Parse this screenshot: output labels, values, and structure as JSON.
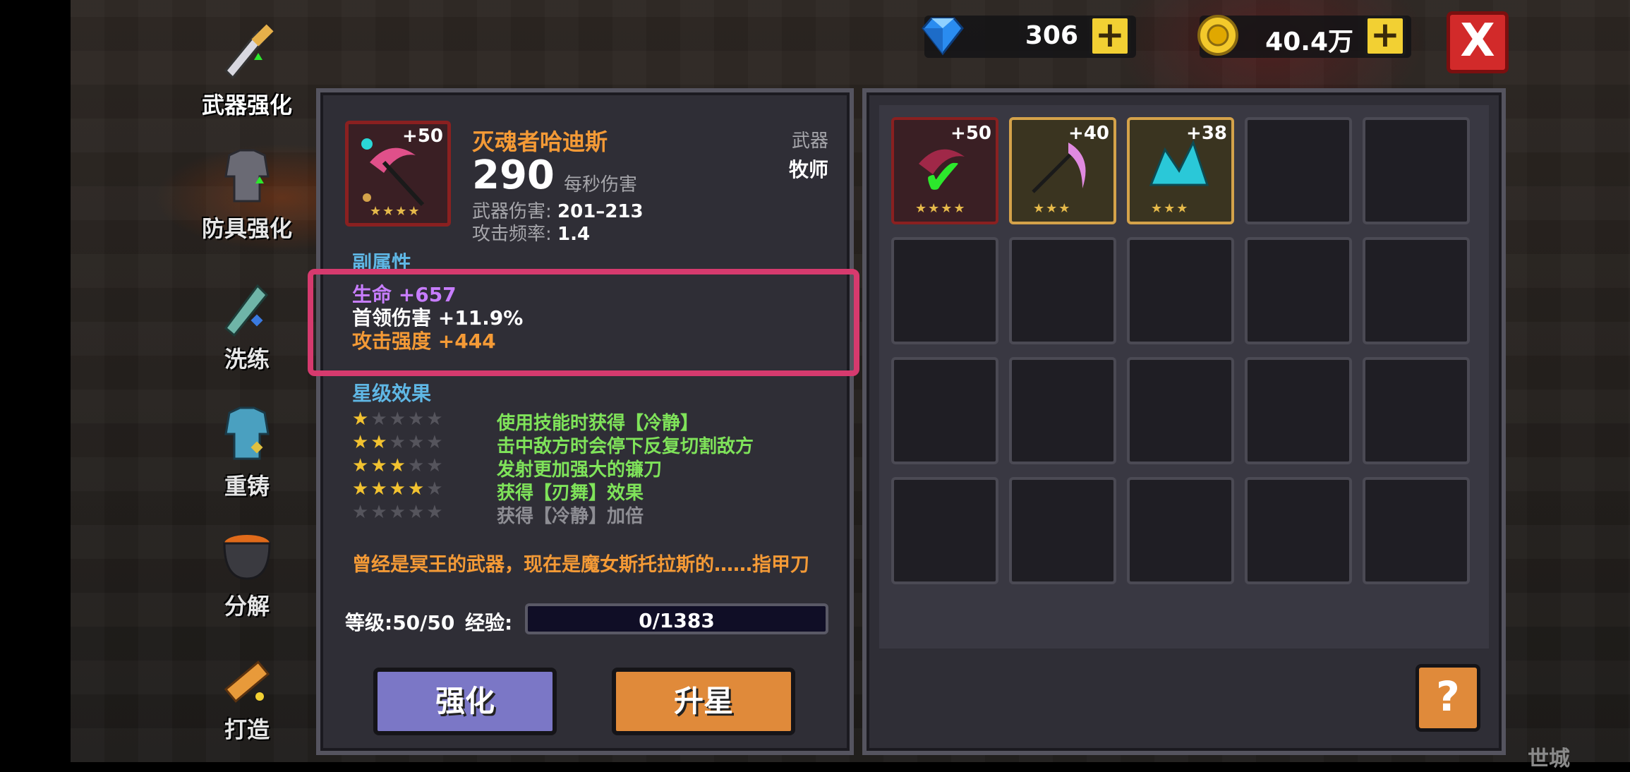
{
  "currency": {
    "gems": "306",
    "gold": "40.4万",
    "plus": "+"
  },
  "close_label": "X",
  "sidebar": {
    "items": [
      {
        "label": "武器强化",
        "icon": "sword-upgrade-icon"
      },
      {
        "label": "防具强化",
        "icon": "armor-upgrade-icon"
      },
      {
        "label": "洗练",
        "icon": "refine-sword-icon"
      },
      {
        "label": "重铸",
        "icon": "reforge-armor-icon"
      },
      {
        "label": "分解",
        "icon": "cauldron-icon"
      },
      {
        "label": "打造",
        "icon": "forge-hammer-icon"
      }
    ]
  },
  "weapon": {
    "name": "灭魂者哈迪斯",
    "dps": "290",
    "dps_label": "每秒伤害",
    "type": "武器",
    "class": "牧师",
    "plus": "+50",
    "stars": "★★★★",
    "damage_label": "武器伤害:",
    "damage_value": "201–213",
    "rate_label": "攻击频率:",
    "rate_value": "1.4"
  },
  "sub_attr": {
    "title": "副属性",
    "stats": [
      {
        "text": "生命 +657",
        "color": "#c77dff"
      },
      {
        "text": "首领伤害 +11.9%",
        "color": "#ffffff"
      },
      {
        "text": "攻击强度 +444",
        "color": "#f49a36"
      }
    ]
  },
  "star_effects": {
    "title": "星级效果",
    "rows": [
      {
        "on": 1,
        "text": "使用技能时获得【冷静】"
      },
      {
        "on": 2,
        "text": "击中敌方时会停下反复切割敌方"
      },
      {
        "on": 3,
        "text": "发射更加强大的镰刀"
      },
      {
        "on": 4,
        "text": "获得【刃舞】效果"
      },
      {
        "on": 0,
        "text": "获得【冷静】加倍"
      }
    ]
  },
  "description": "曾经是冥王的武器，现在是魔女斯托拉斯的……指甲刀",
  "level": "等级:50/50",
  "exp_label": "经验:",
  "exp_value": "0/1383",
  "exp_fraction": 0,
  "buttons": {
    "enhance": "强化",
    "star_up": "升星"
  },
  "inventory": [
    {
      "plus": "+50",
      "stars": "★★★★",
      "state": "equipped"
    },
    {
      "plus": "+40",
      "stars": "★★★",
      "state": "filled"
    },
    {
      "plus": "+38",
      "stars": "★★★",
      "state": "filled"
    }
  ],
  "help_label": "?",
  "edge_label": "世城"
}
